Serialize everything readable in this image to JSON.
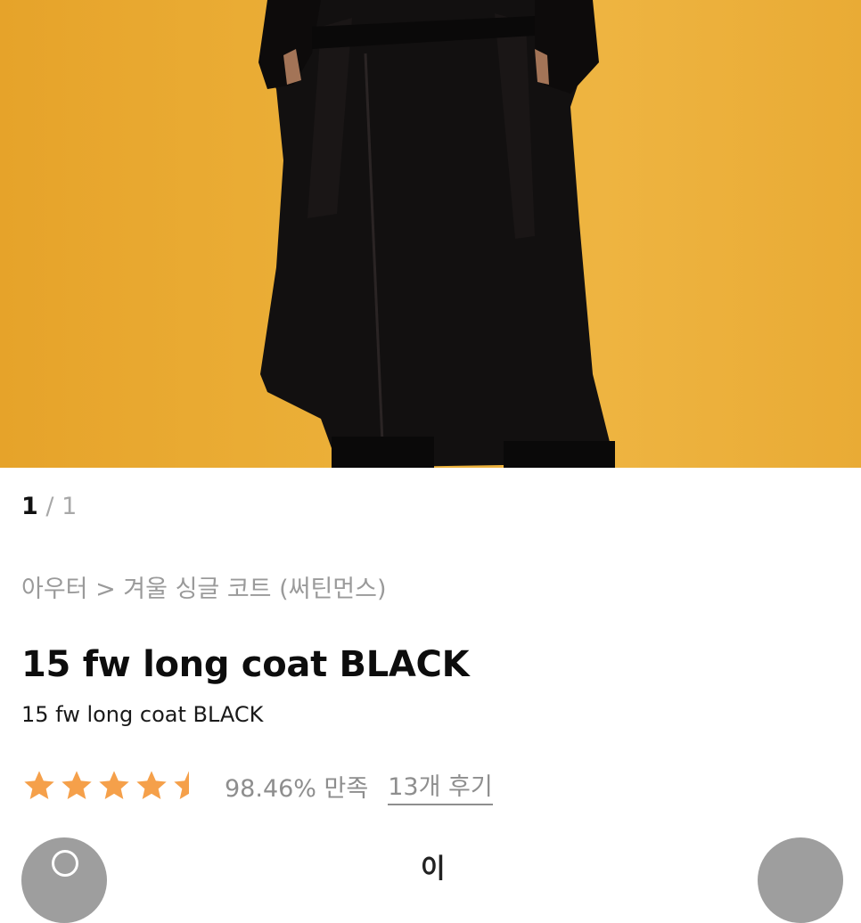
{
  "gallery": {
    "current_index": "1",
    "separator": "/",
    "total": "1",
    "background_color": "#ecb13a",
    "subject_color": "#121010"
  },
  "product": {
    "breadcrumb": "아우터 > 겨울 싱글 코트 (써틴먼스)",
    "name": "15 fw long coat BLACK",
    "subtitle": "15 fw long coat BLACK",
    "rating": {
      "stars": 4.5,
      "max_stars": 5,
      "star_color": "#f5a04a",
      "satisfaction": "98.46% 만족",
      "reviews_label": "13개 후기"
    }
  },
  "bottom_bar": {
    "left_icon": "search-icon",
    "right_icon": "menu-icon",
    "center_partial_text": "이"
  }
}
